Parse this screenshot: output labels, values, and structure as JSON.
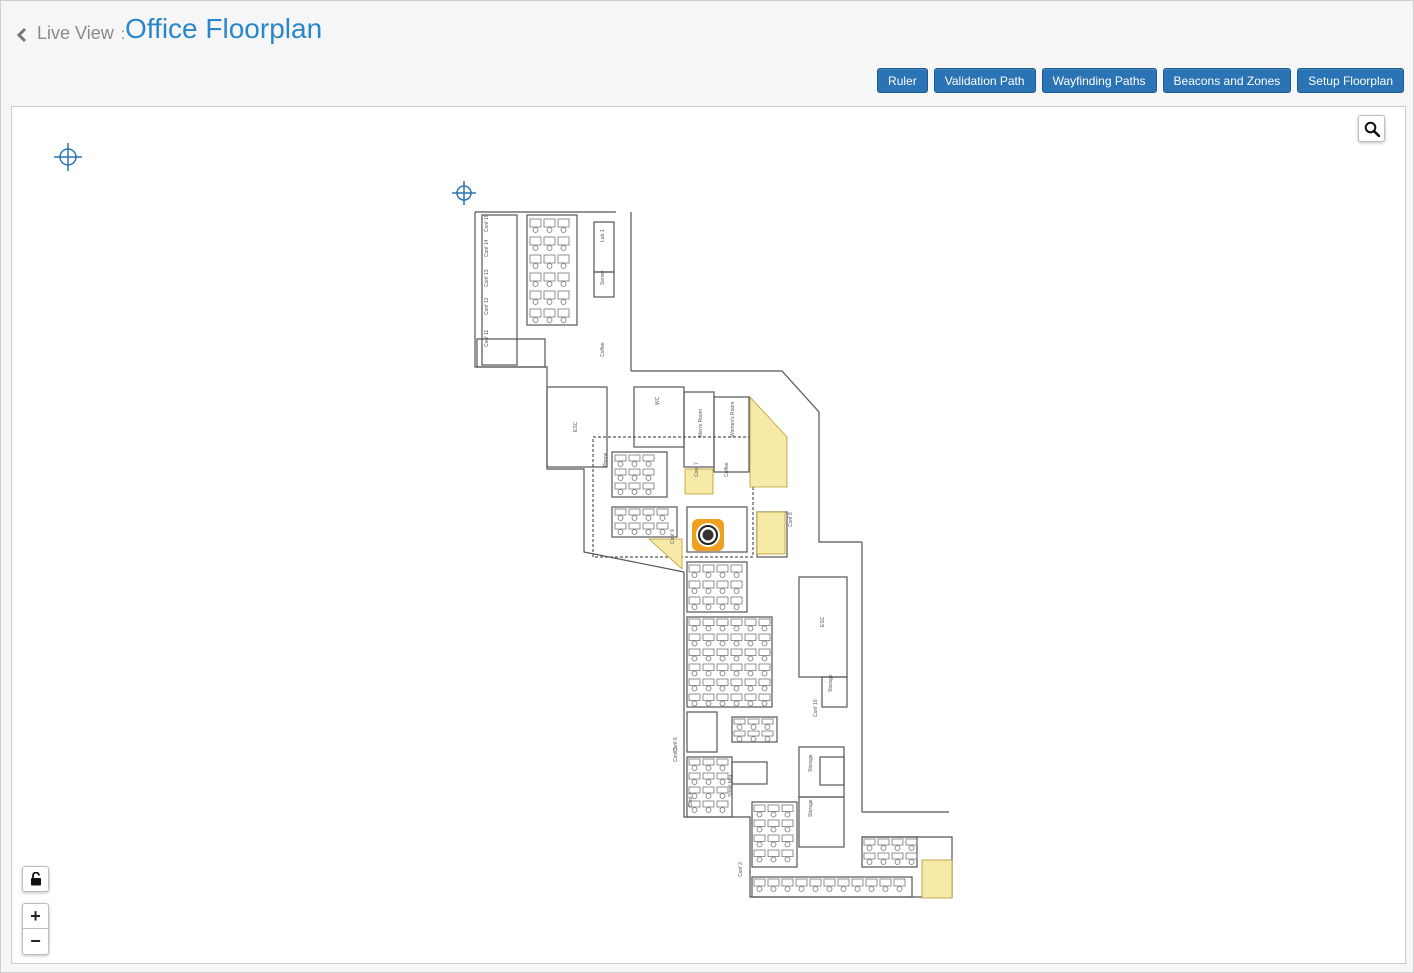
{
  "header": {
    "back_icon": "chevron-left-icon",
    "breadcrumb": "Live View",
    "separator": ":",
    "title": "Office Floorplan"
  },
  "toolbar": {
    "buttons": [
      {
        "label": "Ruler"
      },
      {
        "label": "Validation Path"
      },
      {
        "label": "Wayfinding Paths"
      },
      {
        "label": "Beacons and Zones"
      },
      {
        "label": "Setup Floorplan"
      }
    ]
  },
  "map": {
    "search_icon": "magnifier-icon",
    "lock_icon": "unlocked-padlock-icon",
    "zoom_in_label": "+",
    "zoom_out_label": "−",
    "position_marker_icon": "location-target-icon",
    "anchor_icon": "crosshair-icon",
    "colors": {
      "accent": "#2a87c9",
      "button": "#2a73b4",
      "zone_fill": "#f7eaa8",
      "marker": "#f0a020"
    },
    "room_labels": [
      "Conf 15",
      "Conf 14",
      "Conf 13",
      "Conf 12",
      "Conf 11",
      "Lab 1",
      "Server",
      "Coffee",
      "ESC",
      "WC",
      "Men's Room",
      "Women's Room",
      "Conf 7",
      "Coffee",
      "Conf 8",
      "Conf 9",
      "Phone",
      "ESC",
      "Storage",
      "Conf 10",
      "Conf 6",
      "Conf 5",
      "Storage",
      "Storage",
      "Small Mtg",
      "Conf 4",
      "Conf 3"
    ]
  }
}
